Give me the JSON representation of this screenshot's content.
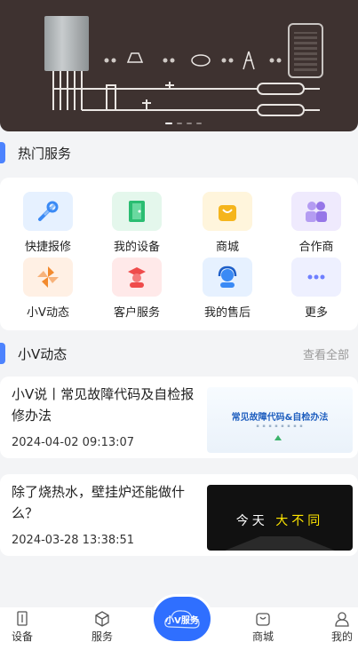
{
  "banner": {
    "slide_count": 4,
    "active_slide": 1
  },
  "hot_services": {
    "title": "热门服务",
    "items": [
      {
        "label": "快捷报修",
        "icon": "tools-icon",
        "bg": "#e6f1ff",
        "color": "#3a8af5"
      },
      {
        "label": "我的设备",
        "icon": "door-icon",
        "bg": "#e4f7ec",
        "color": "#2bbd72"
      },
      {
        "label": "商城",
        "icon": "shopping-bag-icon",
        "bg": "#fff5dc",
        "color": "#f5b51c"
      },
      {
        "label": "合作商",
        "icon": "partners-icon",
        "bg": "#efeafd",
        "color": "#9676e8"
      },
      {
        "label": "小V动态",
        "icon": "pinwheel-icon",
        "bg": "#fff0e4",
        "color": "#f28a2e"
      },
      {
        "label": "客户服务",
        "icon": "graduate-icon",
        "bg": "#ffe9e9",
        "color": "#ef4b4b"
      },
      {
        "label": "我的售后",
        "icon": "headset-icon",
        "bg": "#e6f1ff",
        "color": "#3a8af5"
      },
      {
        "label": "更多",
        "icon": "more-dots-icon",
        "bg": "#eef0ff",
        "color": "#6e7fff"
      }
    ]
  },
  "news": {
    "title": "小V动态",
    "view_all": "查看全部",
    "articles": [
      {
        "title": "小V说丨常见故障代码及自检报修办法",
        "date": "2024-04-02 09:13:07",
        "thumb_title": "常见故障代码&自检办法"
      },
      {
        "title": "除了烧热水，壁挂炉还能做什么？",
        "date": "2024-03-28 13:38:51",
        "thumb_title_a": "今天",
        "thumb_title_b": "大不同"
      }
    ]
  },
  "tabbar": {
    "items": [
      {
        "label": "设备",
        "icon": "device-icon"
      },
      {
        "label": "服务",
        "icon": "service-box-icon"
      },
      {
        "label": "商城",
        "icon": "mall-icon"
      },
      {
        "label": "我的",
        "icon": "profile-icon"
      }
    ],
    "center": {
      "label": "小V服务",
      "icon": "cloud-icon"
    }
  },
  "colors": {
    "accent": "#2f6fff",
    "banner_bg": "#3e3230",
    "page_bg": "#f3f4f6"
  }
}
